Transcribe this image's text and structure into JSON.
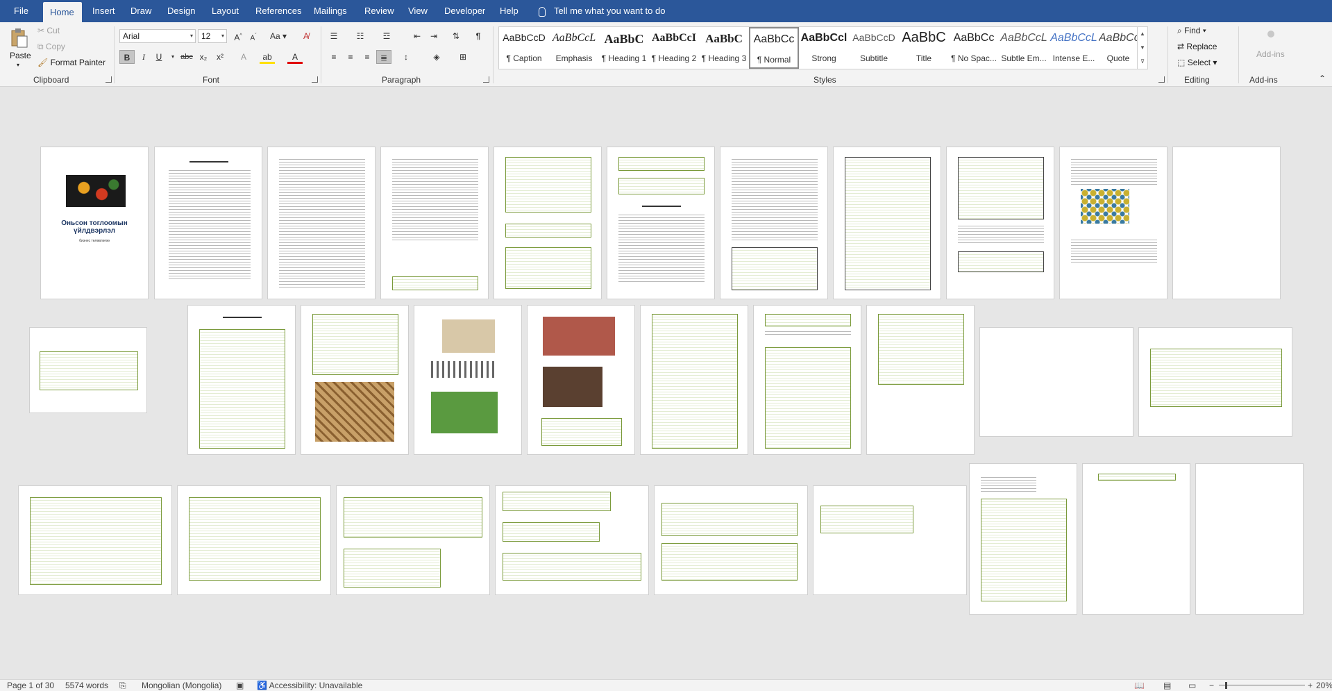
{
  "tabs": [
    "File",
    "Home",
    "Insert",
    "Draw",
    "Design",
    "Layout",
    "References",
    "Mailings",
    "Review",
    "View",
    "Developer",
    "Help"
  ],
  "active_tab": "Home",
  "tell_me": "Tell me what you want to do",
  "clipboard": {
    "paste": "Paste",
    "cut": "Cut",
    "copy": "Copy",
    "format_painter": "Format Painter",
    "label": "Clipboard"
  },
  "font": {
    "name": "Arial",
    "size": "12",
    "label": "Font",
    "bold": "B",
    "italic": "I",
    "underline": "U",
    "strike": "abc",
    "sub": "x₂",
    "sup": "x²"
  },
  "paragraph": {
    "label": "Paragraph",
    "pilcrow": "¶"
  },
  "styles": {
    "label": "Styles",
    "items": [
      {
        "preview": "AaBbCcD",
        "name": "¶ Caption"
      },
      {
        "preview": "AaBbCcL",
        "name": "Emphasis"
      },
      {
        "preview": "AaBbC",
        "name": "¶ Heading 1"
      },
      {
        "preview": "AaBbCcI",
        "name": "¶ Heading 2"
      },
      {
        "preview": "AaBbC",
        "name": "¶ Heading 3"
      },
      {
        "preview": "AaBbCc",
        "name": "¶ Normal"
      },
      {
        "preview": "AaBbCcl",
        "name": "Strong"
      },
      {
        "preview": "AaBbCcD",
        "name": "Subtitle"
      },
      {
        "preview": "AaBbC",
        "name": "Title"
      },
      {
        "preview": "AaBbCc",
        "name": "¶ No Spac..."
      },
      {
        "preview": "AaBbCcL",
        "name": "Subtle Em..."
      },
      {
        "preview": "AaBbCcL",
        "name": "Intense E..."
      },
      {
        "preview": "AaBbCc",
        "name": "Quote"
      }
    ],
    "selected": "¶ Normal"
  },
  "editing": {
    "find": "Find",
    "replace": "Replace",
    "select": "Select",
    "label": "Editing"
  },
  "addins": {
    "button": "Add-ins",
    "label": "Add-ins"
  },
  "cover_page": {
    "title_line1": "Оньсон тоглоомын",
    "title_line2": "үйлдвэрлэл",
    "subtitle": "бизнес төлөвлөгөө"
  },
  "status": {
    "page": "Page 1 of 30",
    "words": "5574 words",
    "language": "Mongolian (Mongolia)",
    "accessibility": "Accessibility: Unavailable",
    "zoom": "20%"
  },
  "colors": {
    "word_blue": "#2b579a",
    "table_green": "#7a9a3a"
  }
}
